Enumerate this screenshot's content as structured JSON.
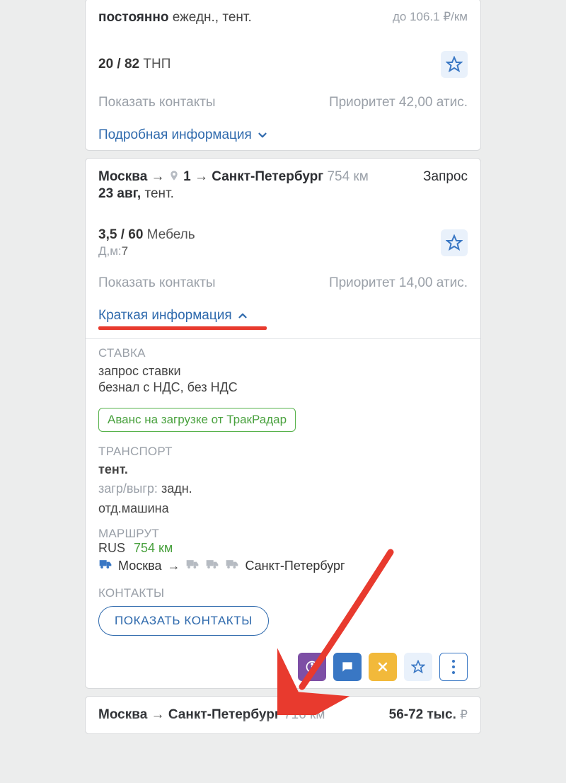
{
  "card1": {
    "schedule_bold": "постоянно",
    "schedule_rest": "ежедн., тент.",
    "price_small": "до 106.1 ₽/км",
    "cargo_weight": "20 / 82",
    "cargo_type": "ТНП",
    "contacts_link": "Показать контакты",
    "priority": "Приоритет 42,00 атис.",
    "expand": "Подробная информация"
  },
  "card2": {
    "from": "Москва",
    "waypoint_count": "1",
    "to": "Санкт-Петербург",
    "distance": "754 км",
    "query_label": "Запрос",
    "date": "23 авг,",
    "body_type": "тент.",
    "cargo_weight": "3,5 / 60",
    "cargo_type": "Мебель",
    "dims_label": "Д,м:",
    "dims_value": "7",
    "contacts_link": "Показать контакты",
    "priority": "Приоритет 14,00 атис.",
    "collapse_label": "Краткая информация",
    "rate": {
      "heading": "СТАВКА",
      "line1": "запрос ставки",
      "line2": "безнал с НДС, без НДС",
      "badge": "Аванс на загрузке от ТракРадар"
    },
    "transport": {
      "heading": "ТРАНСПОРТ",
      "body": "тент.",
      "loading_label": "загр/выгр:",
      "loading_value": "задн.",
      "extra": "отд.машина"
    },
    "route": {
      "heading": "МАРШРУТ",
      "country": "RUS",
      "distance": "754 км",
      "from": "Москва",
      "to": "Санкт-Петербург"
    },
    "contacts": {
      "heading": "КОНТАКТЫ",
      "button": "ПОКАЗАТЬ КОНТАКТЫ"
    }
  },
  "card3": {
    "from": "Москва",
    "to": "Санкт-Петербург",
    "distance": "716 км",
    "price_main": "56-72 тыс.",
    "currency": "₽"
  }
}
